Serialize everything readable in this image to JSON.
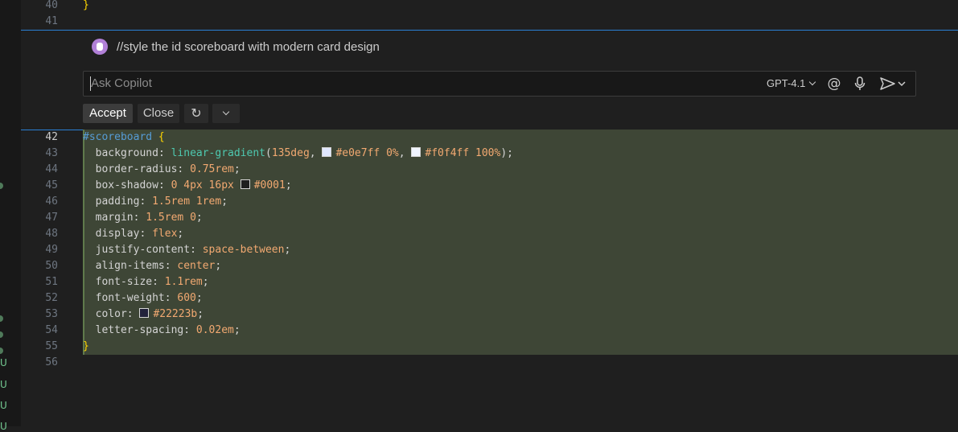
{
  "editor": {
    "above_lines": [
      {
        "num": "40",
        "text": "}"
      },
      {
        "num": "41",
        "text": ""
      }
    ],
    "lines": [
      {
        "num": "42"
      },
      {
        "num": "43"
      },
      {
        "num": "44"
      },
      {
        "num": "45"
      },
      {
        "num": "46"
      },
      {
        "num": "47"
      },
      {
        "num": "48"
      },
      {
        "num": "49"
      },
      {
        "num": "50"
      },
      {
        "num": "51"
      },
      {
        "num": "52"
      },
      {
        "num": "53"
      },
      {
        "num": "54"
      },
      {
        "num": "55"
      },
      {
        "num": "56"
      }
    ],
    "code": {
      "selector": "#scoreboard",
      "open_brace": "{",
      "close_brace": "}",
      "background_prop": "background",
      "background_fn": "linear-gradient",
      "background_deg": "135deg",
      "color1": "#e0e7ff",
      "color1_stop": "0%",
      "color2": "#f0f4ff",
      "color2_stop": "100%",
      "border_radius_prop": "border-radius",
      "border_radius_val": "0.75rem",
      "box_shadow_prop": "box-shadow",
      "box_shadow_val": "0 4px 16px",
      "box_shadow_color": "#0001",
      "padding_prop": "padding",
      "padding_val": "1.5rem 1rem",
      "margin_prop": "margin",
      "margin_val": "1.5rem 0",
      "display_prop": "display",
      "display_val": "flex",
      "justify_prop": "justify-content",
      "justify_val": "space-between",
      "align_prop": "align-items",
      "align_val": "center",
      "font_size_prop": "font-size",
      "font_size_val": "1.1rem",
      "font_weight_prop": "font-weight",
      "font_weight_val": "600",
      "color_prop": "color",
      "color_val": "#22223b",
      "letter_prop": "letter-spacing",
      "letter_val": "0.02em"
    }
  },
  "inline_chat": {
    "prompt": "//style the id scoreboard with modern card design",
    "placeholder": "Ask Copilot",
    "model": "GPT-4.1",
    "mention_icon": "at-icon",
    "mic_icon": "microphone-icon",
    "send_icon": "send-icon",
    "accept_label": "Accept",
    "close_label": "Close",
    "rerun_icon": "rerun-icon",
    "more_icon": "chevron-down-icon"
  },
  "colors": {
    "accent": "#2b7fd4",
    "diff_added_bg": "#3e4636",
    "swatch_1": "#e0e7ff",
    "swatch_2": "#f0f4ff",
    "swatch_3": "#0001",
    "swatch_4": "#22223b"
  },
  "gutter_markers": [
    "U",
    "U",
    "U",
    "U"
  ]
}
